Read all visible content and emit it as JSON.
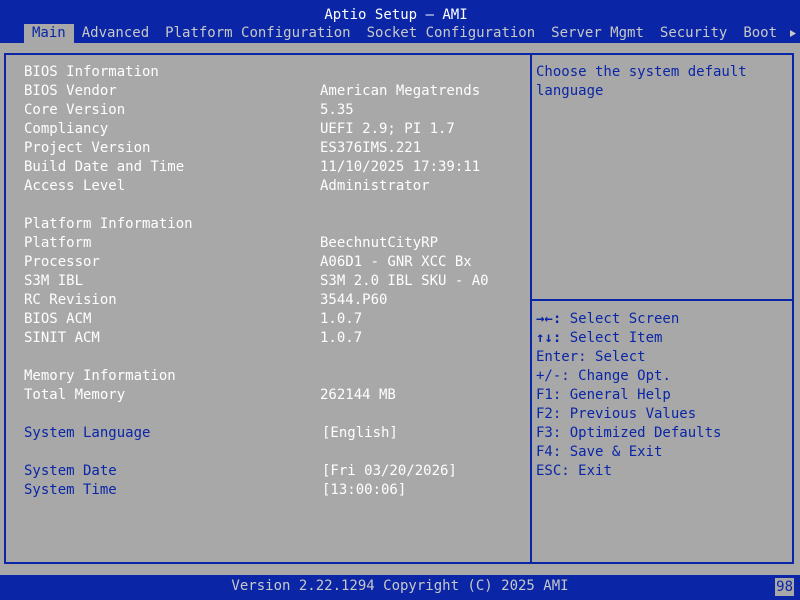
{
  "app": {
    "title": "Aptio Setup – AMI"
  },
  "tabs": [
    {
      "label": "Main",
      "active": true
    },
    {
      "label": "Advanced"
    },
    {
      "label": "Platform Configuration"
    },
    {
      "label": "Socket Configuration"
    },
    {
      "label": "Server Mgmt"
    },
    {
      "label": "Security"
    },
    {
      "label": "Boot"
    }
  ],
  "bios_info": {
    "heading": "BIOS Information",
    "rows": [
      {
        "label": "BIOS Vendor",
        "value": "American Megatrends"
      },
      {
        "label": "Core Version",
        "value": "5.35"
      },
      {
        "label": "Compliancy",
        "value": "UEFI 2.9; PI 1.7"
      },
      {
        "label": "Project Version",
        "value": "ES376IMS.221"
      },
      {
        "label": "Build Date and Time",
        "value": "11/10/2025 17:39:11"
      },
      {
        "label": "Access Level",
        "value": "Administrator"
      }
    ]
  },
  "platform_info": {
    "heading": "Platform Information",
    "rows": [
      {
        "label": "Platform",
        "value": "BeechnutCityRP"
      },
      {
        "label": "Processor",
        "value": "A06D1 - GNR XCC Bx"
      },
      {
        "label": "S3M IBL",
        "value": "S3M 2.0 IBL SKU - A0"
      },
      {
        "label": "RC Revision",
        "value": "3544.P60"
      },
      {
        "label": "BIOS ACM",
        "value": "1.0.7"
      },
      {
        "label": "SINIT ACM",
        "value": "1.0.7"
      }
    ]
  },
  "memory_info": {
    "heading": "Memory Information",
    "rows": [
      {
        "label": "Total Memory",
        "value": "262144 MB"
      }
    ]
  },
  "options": {
    "language": {
      "label": "System Language",
      "value": "[English]"
    },
    "date": {
      "label": "System Date",
      "value": "[Fri 03/20/2026]"
    },
    "time": {
      "label": "System Time",
      "value": "[13:00:06]"
    }
  },
  "help": {
    "text": "Choose the system default language"
  },
  "keys": [
    {
      "key": "→←: ",
      "desc": "Select Screen"
    },
    {
      "key": "↑↓: ",
      "desc": "Select Item"
    },
    {
      "key": "Enter: ",
      "desc": "Select"
    },
    {
      "key": "+/-: ",
      "desc": "Change Opt."
    },
    {
      "key": "F1: ",
      "desc": "General Help"
    },
    {
      "key": "F2: ",
      "desc": "Previous Values"
    },
    {
      "key": "F3: ",
      "desc": "Optimized Defaults"
    },
    {
      "key": "F4: ",
      "desc": "Save & Exit"
    },
    {
      "key": "ESC: ",
      "desc": "Exit"
    }
  ],
  "footer": {
    "version": "Version 2.22.1294 Copyright (C) 2025 AMI",
    "page": "98"
  },
  "colors": {
    "bar_blue": "#0a26a6",
    "panel_gray": "#a8a8a8",
    "text_white": "#ffffff"
  },
  "icons": {
    "tab_scroll": "triangle-right-icon"
  }
}
